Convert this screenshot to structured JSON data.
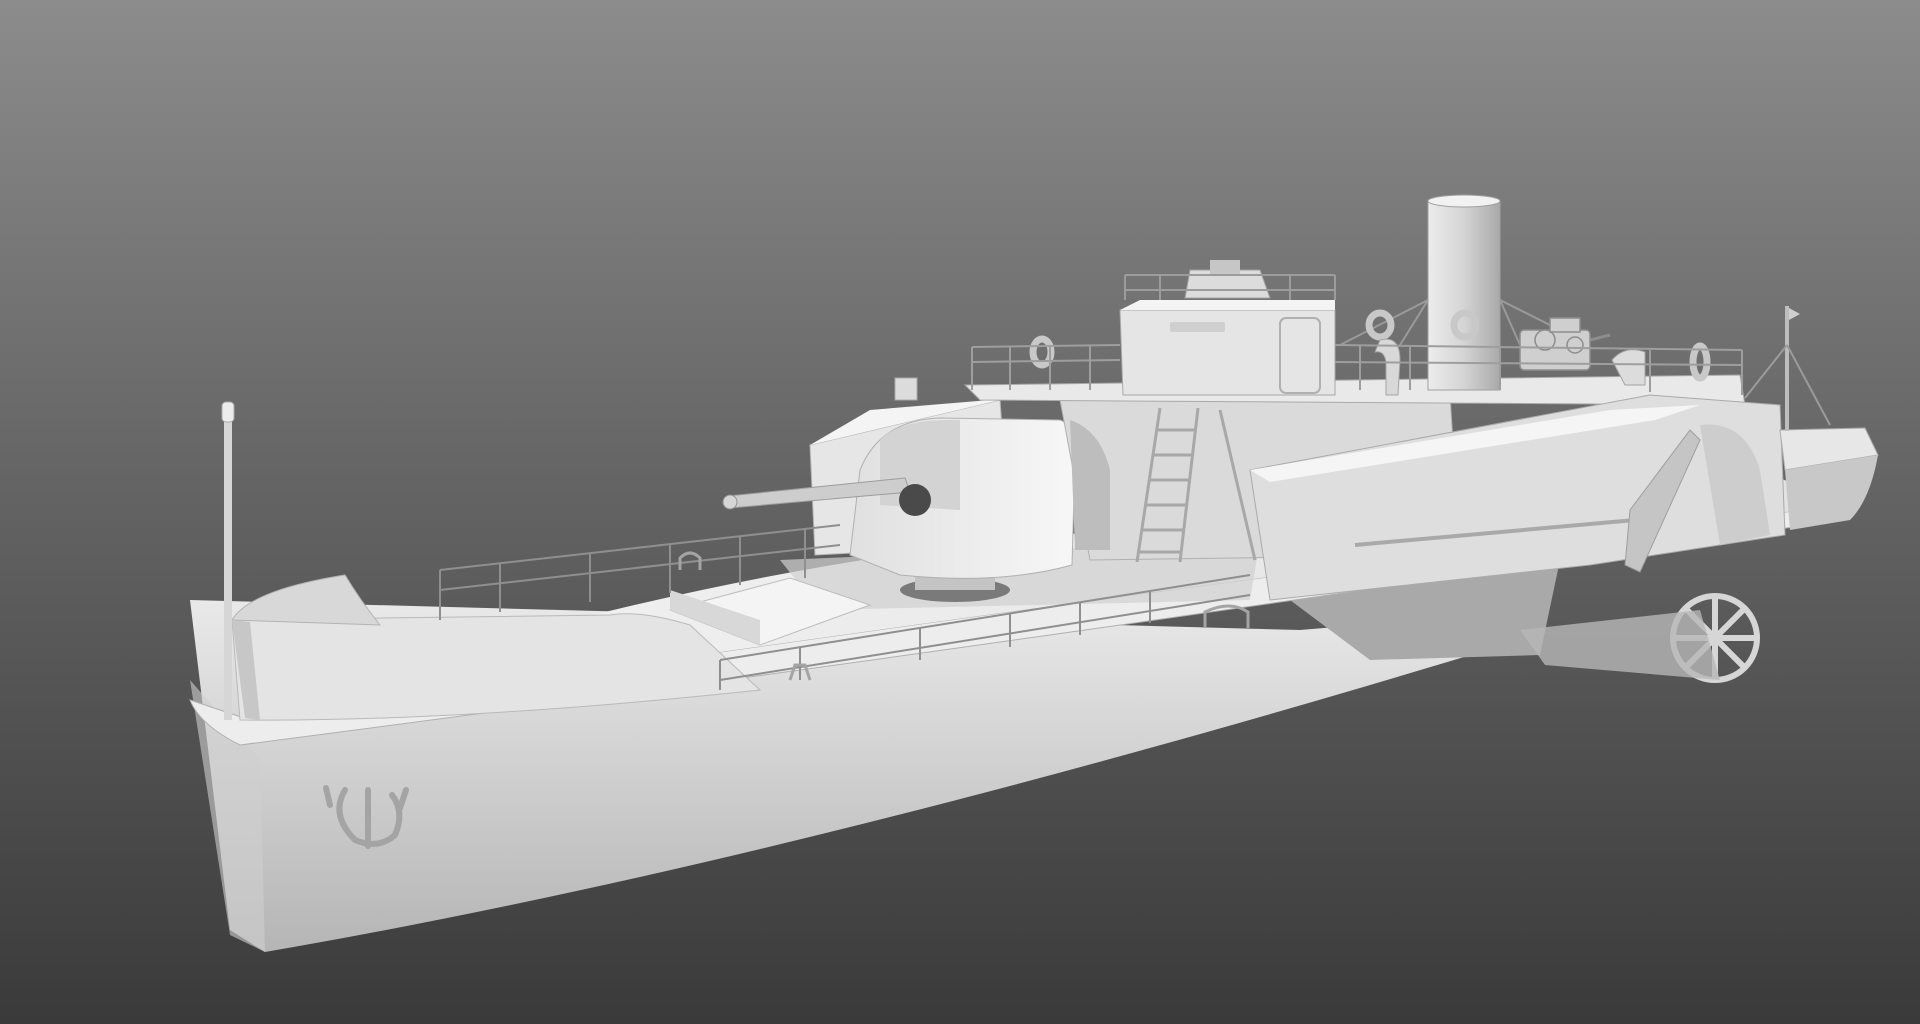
{
  "render": {
    "subject": "riverine-paddle-gunboat-clay-render",
    "colors": {
      "bg_top": "#8c8c8c",
      "bg_bottom": "#363636",
      "clay_light": "#f2f2f2",
      "clay_mid": "#d9d9d9",
      "clay_shade": "#b8b8b8",
      "clay_dark": "#9a9a9a",
      "line": "#8a8a8a"
    },
    "icons": [
      "anchor-emblem-icon",
      "life-ring-icon",
      "paddle-wheel-icon"
    ]
  }
}
